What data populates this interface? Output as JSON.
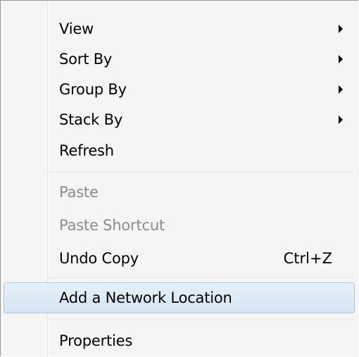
{
  "context_menu": {
    "items": [
      {
        "label": "View",
        "has_submenu": true,
        "enabled": true
      },
      {
        "label": "Sort By",
        "has_submenu": true,
        "enabled": true
      },
      {
        "label": "Group By",
        "has_submenu": true,
        "enabled": true
      },
      {
        "label": "Stack By",
        "has_submenu": true,
        "enabled": true
      },
      {
        "label": "Refresh",
        "has_submenu": false,
        "enabled": true
      },
      {
        "label": "Paste",
        "has_submenu": false,
        "enabled": false
      },
      {
        "label": "Paste Shortcut",
        "has_submenu": false,
        "enabled": false
      },
      {
        "label": "Undo Copy",
        "shortcut": "Ctrl+Z",
        "has_submenu": false,
        "enabled": true
      },
      {
        "label": "Add a Network Location",
        "has_submenu": false,
        "enabled": true,
        "highlighted": true
      },
      {
        "label": "Properties",
        "has_submenu": false,
        "enabled": true
      }
    ]
  },
  "colors": {
    "menu_background": "#f5f5f5",
    "highlight_border": "#a8c8e4",
    "highlight_fill": "#dbe9f5",
    "disabled_text": "#8c8c8c"
  }
}
